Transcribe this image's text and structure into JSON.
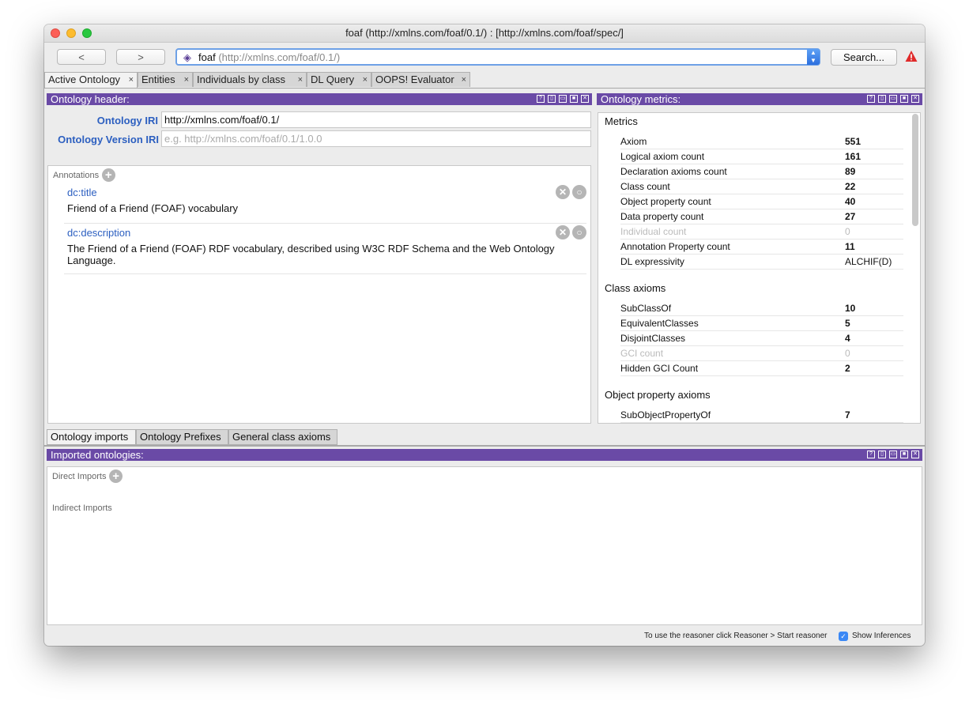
{
  "window": {
    "title": "foaf (http://xmlns.com/foaf/0.1/)  : [http://xmlns.com/foaf/spec/]"
  },
  "toolbar": {
    "back_label": "<",
    "forward_label": ">",
    "entity_name": "foaf",
    "entity_iri": "(http://xmlns.com/foaf/0.1/)",
    "search_label": "Search...",
    "warning_icon": "warning-icon"
  },
  "tabs": [
    {
      "label": "Active Ontology",
      "active": true
    },
    {
      "label": "Entities"
    },
    {
      "label": "Individuals by class"
    },
    {
      "label": "DL Query"
    },
    {
      "label": "OOPS! Evaluator"
    }
  ],
  "close_glyph": "×",
  "ontology_header": {
    "title": "Ontology header:",
    "iri_label": "Ontology IRI",
    "iri_value": "http://xmlns.com/foaf/0.1/",
    "version_label": "Ontology Version IRI",
    "version_placeholder": "e.g. http://xmlns.com/foaf/0.1/1.0.0",
    "annotations_label": "Annotations",
    "annotations": [
      {
        "property": "dc:title",
        "value": "Friend of a Friend (FOAF) vocabulary"
      },
      {
        "property": "dc:description",
        "value": "The Friend of a Friend (FOAF) RDF vocabulary, described using W3C RDF Schema and the Web Ontology Language."
      }
    ]
  },
  "metrics": {
    "title": "Ontology metrics:",
    "groups": [
      {
        "name": "Metrics",
        "rows": [
          {
            "name": "Axiom",
            "value": "551"
          },
          {
            "name": "Logical axiom count",
            "value": "161"
          },
          {
            "name": "Declaration axioms count",
            "value": "89"
          },
          {
            "name": "Class count",
            "value": "22"
          },
          {
            "name": "Object property count",
            "value": "40"
          },
          {
            "name": "Data property count",
            "value": "27"
          },
          {
            "name": "Individual count",
            "value": "0"
          },
          {
            "name": "Annotation Property count",
            "value": "11"
          },
          {
            "name": "DL expressivity",
            "value": "ALCHIF(D)"
          }
        ]
      },
      {
        "name": "Class axioms",
        "rows": [
          {
            "name": "SubClassOf",
            "value": "10"
          },
          {
            "name": "EquivalentClasses",
            "value": "5"
          },
          {
            "name": "DisjointClasses",
            "value": "4"
          },
          {
            "name": "GCI count",
            "value": "0"
          },
          {
            "name": "Hidden GCI Count",
            "value": "2"
          }
        ]
      },
      {
        "name": "Object property axioms",
        "rows": [
          {
            "name": "SubObjectPropertyOf",
            "value": "7"
          }
        ]
      }
    ]
  },
  "bottom_tabs": [
    {
      "label": "Ontology imports",
      "active": true
    },
    {
      "label": "Ontology Prefixes"
    },
    {
      "label": "General class axioms"
    }
  ],
  "imports": {
    "title": "Imported ontologies:",
    "direct_label": "Direct Imports",
    "indirect_label": "Indirect Imports"
  },
  "status": {
    "reasoner_hint": "To use the reasoner click Reasoner > Start reasoner",
    "show_inferences_label": "Show Inferences",
    "show_inferences_checked": true
  },
  "colors": {
    "panel_header": "#6a4aa6",
    "link_blue": "#2c5fc0",
    "focus_blue": "#6ea1e6",
    "warning_red": "#e02a2a"
  }
}
